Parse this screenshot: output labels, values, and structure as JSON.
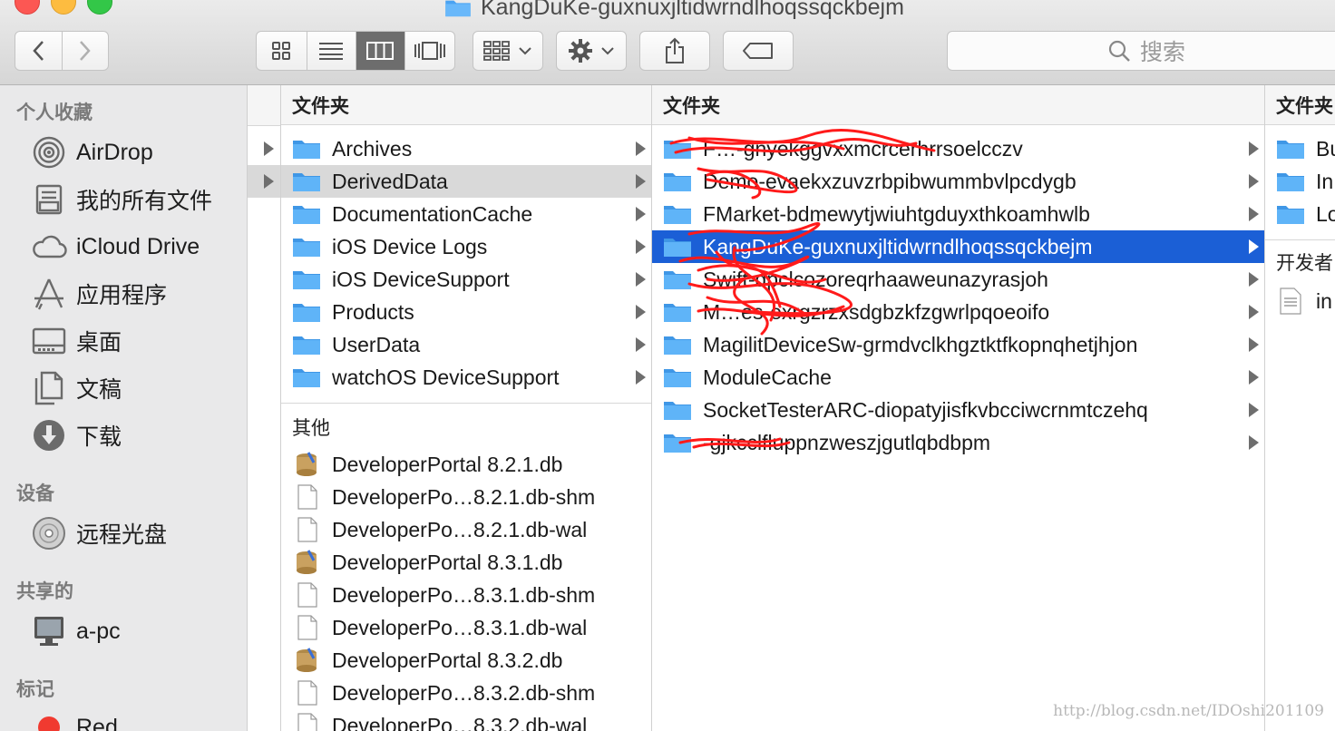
{
  "window": {
    "title": "KangDuKe-guxnuxjltidwrndlhoqssqckbejm"
  },
  "toolbar": {
    "search_placeholder": "搜索"
  },
  "colors": {
    "accent": "#1b5fd6",
    "folder": "#4aa3f2",
    "sidebar_bg": "#e9e9ea"
  },
  "sidebar": {
    "favorites_header": "个人收藏",
    "favorites": [
      {
        "label": "AirDrop",
        "icon": "airdrop-icon"
      },
      {
        "label": "我的所有文件",
        "icon": "all-files-icon"
      },
      {
        "label": "iCloud Drive",
        "icon": "cloud-icon"
      },
      {
        "label": "应用程序",
        "icon": "applications-icon"
      },
      {
        "label": "桌面",
        "icon": "desktop-icon"
      },
      {
        "label": "文稿",
        "icon": "documents-icon"
      },
      {
        "label": "下载",
        "icon": "downloads-icon"
      }
    ],
    "devices_header": "设备",
    "devices": [
      {
        "label": "远程光盘",
        "icon": "remote-disc-icon"
      }
    ],
    "shared_header": "共享的",
    "shared": [
      {
        "label": "a-pc",
        "icon": "computer-icon"
      }
    ],
    "tags_header": "标记",
    "tags": [
      {
        "label": "Red",
        "color": "#f03a30"
      }
    ]
  },
  "col1": {
    "folders_header": "文件夹",
    "folders": [
      "Archives",
      "DerivedData",
      "DocumentationCache",
      "iOS Device Logs",
      "iOS DeviceSupport",
      "Products",
      "UserData",
      "watchOS DeviceSupport"
    ],
    "other_header": "其他",
    "files": [
      {
        "name": "DeveloperPortal 8.2.1.db",
        "icon": "database-icon"
      },
      {
        "name": "DeveloperPo…8.2.1.db-shm",
        "icon": "document-icon"
      },
      {
        "name": "DeveloperPo…8.2.1.db-wal",
        "icon": "document-icon"
      },
      {
        "name": "DeveloperPortal 8.3.1.db",
        "icon": "database-icon"
      },
      {
        "name": "DeveloperPo…8.3.1.db-shm",
        "icon": "document-icon"
      },
      {
        "name": "DeveloperPo…8.3.1.db-wal",
        "icon": "document-icon"
      },
      {
        "name": "DeveloperPortal 8.3.2.db",
        "icon": "database-icon"
      },
      {
        "name": "DeveloperPo…8.3.2.db-shm",
        "icon": "document-icon"
      },
      {
        "name": "DeveloperPo…8.3.2.db-wal",
        "icon": "document-icon"
      }
    ]
  },
  "col2": {
    "header": "文件夹",
    "folders": [
      "F…-gnyekggvxxmcrcerhrrsoelcczv",
      "Demo-evaekxzuvzrbpibwummbvlpcdygb",
      "FMarket-bdmewytjwiuhtgduyxthkoamhwlb",
      "KangDuKe-guxnuxjltidwrndlhoqssqckbejm",
      "Swift-dpclcozoreqrhaaweunazyrasjoh",
      "M…es-exrgzrzxsdgbzkfzgwrlpqoeoifo",
      "MagilitDeviceSw-grmdvclkhgztktfkopnqhetjhjon",
      "ModuleCache",
      "SocketTesterARC-diopatyjisfkvbcciwcrnmtczehq",
      "-gjkcclfluppnzweszjgutlqbdbpm"
    ]
  },
  "col3": {
    "header": "文件夹",
    "folders": [
      "Bu",
      "In",
      "Lo"
    ],
    "developer_header": "开发者",
    "files": [
      "in"
    ]
  },
  "watermark": "http://blog.csdn.net/IDOshi201109"
}
